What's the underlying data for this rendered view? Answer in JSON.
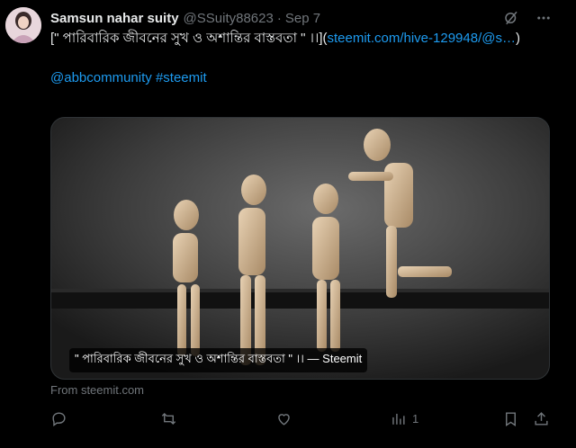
{
  "tweet": {
    "author_name": "Samsun nahar suity",
    "author_handle": "@SSuity88623",
    "separator": "·",
    "date": "Sep 7",
    "text_part1": "[\" পারিবারিক জীবনের সুখ ও অশান্তির বাস্তবতা \" ।।](",
    "link_text": "steemit.com/hive-129948/@s…",
    "text_part2": ")",
    "hashtags": "@abbcommunity #steemit",
    "image_caption": "\" পারিবারিক জীবনের সুখ ও অশান্তির বাস্তবতা \" ।। — Steemit",
    "from_source": "From steemit.com",
    "views_count": "1"
  },
  "icons": {
    "grok": "grok-icon",
    "more": "more-icon",
    "reply": "reply-icon",
    "retweet": "retweet-icon",
    "like": "like-icon",
    "views": "views-icon",
    "bookmark": "bookmark-icon",
    "share": "share-icon"
  },
  "colors": {
    "background": "#000000",
    "text": "#e7e9ea",
    "muted": "#71767b",
    "link": "#1d9bf0"
  }
}
